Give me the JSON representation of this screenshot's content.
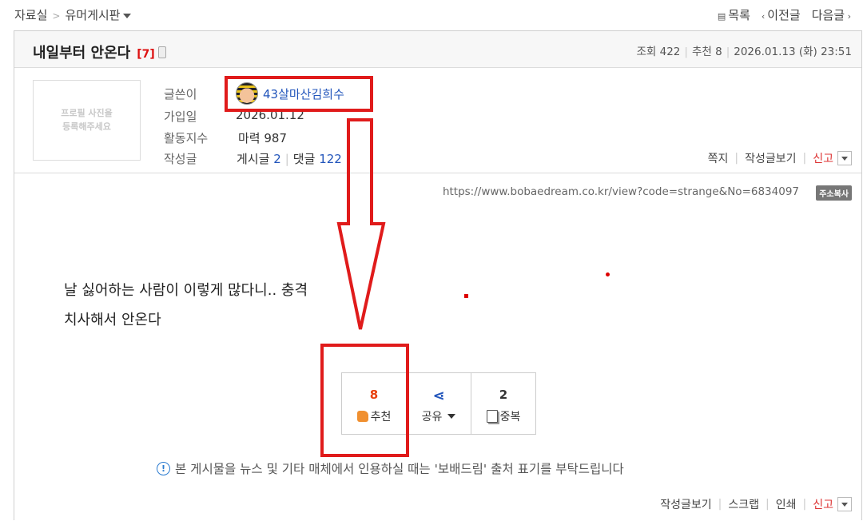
{
  "breadcrumb": {
    "root": "자료실",
    "separator": ">",
    "board": "유머게시판"
  },
  "topnav": {
    "list_label": "목록",
    "prev_label": "이전글",
    "next_label": "다음글"
  },
  "post": {
    "title": "내일부터 안온다",
    "comment_count": "[7]",
    "meta": {
      "views_label": "조회",
      "views": "422",
      "recommend_label": "추천",
      "recommend": "8",
      "datetime": "2026.01.13 (화) 23:51"
    },
    "profile_placeholder_line1": "프로필 사진을",
    "profile_placeholder_line2": "등록해주세요",
    "author_label": "글쓴이",
    "author": "43살마산김희수",
    "joined_label": "가입일",
    "joined": "2026.01.12",
    "activity_label": "활동지수",
    "activity": "마력 987",
    "posts_label": "작성글",
    "posts_text": "게시글",
    "posts_count": "2",
    "comments_text": "댓글",
    "comments_count": "122",
    "actions": {
      "message": "쪽지",
      "view_posts": "작성글보기",
      "report": "신고"
    },
    "url": "https://www.bobaedream.co.kr/view?code=strange&No=6834097",
    "copy_label": "주소복사",
    "body_line1": "날 싫어하는 사람이 이렇게 많다니.. 충격",
    "body_line2": "치사해서 안온다",
    "votes": {
      "recommend_count": "8",
      "recommend_label": "추천",
      "share_label": "공유",
      "dup_count": "2",
      "dup_label": "중복"
    },
    "notice": "본 게시물을 뉴스 및 기타 매체에서 인용하실 때는 '보배드림' 출처 표기를 부탁드립니다",
    "bottom_actions": {
      "view_posts": "작성글보기",
      "scrap": "스크랩",
      "print": "인쇄",
      "report": "신고"
    }
  },
  "colors": {
    "annotation_red": "#e01b1b",
    "link_blue": "#2255bb",
    "recommend_orange": "#e8400c",
    "report_red": "#d33"
  }
}
